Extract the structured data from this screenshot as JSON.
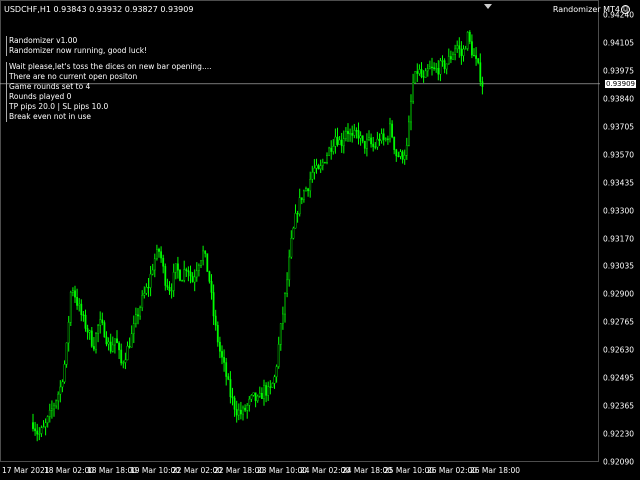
{
  "header": {
    "symbol_line": "USDCHF,H1  0.93843 0.93932 0.93827 0.93909",
    "ea_name": "Randomizer MT4",
    "ea_icon": "smiley-icon"
  },
  "log_lines": [
    "Randomizer v1.00",
    "Randomizer now running, good luck!",
    "",
    "Wait please,let's toss the dices on new bar opening....",
    "There are no current open positon",
    "Game rounds set to 4",
    "Rounds played 0",
    "TP pips 20.0 | SL pips 10.0",
    "Break even not in use"
  ],
  "price_scale": [
    "0.94240",
    "0.94105",
    "0.93975",
    "0.93840",
    "0.93705",
    "0.93570",
    "0.93435",
    "0.93300",
    "0.93170",
    "0.93035",
    "0.92900",
    "0.92765",
    "0.92630",
    "0.92495",
    "0.92365",
    "0.92230",
    "0.92090"
  ],
  "bid_price": "0.93909",
  "time_axis": [
    "17 Mar 2021",
    "18 Mar 02:00",
    "18 Mar 18:00",
    "19 Mar 10:00",
    "22 Mar 02:00",
    "22 Mar 18:00",
    "23 Mar 10:00",
    "24 Mar 02:00",
    "24 Mar 18:00",
    "25 Mar 10:00",
    "26 Mar 02:00",
    "26 Mar 18:00"
  ],
  "colors": {
    "candle": "#00ff00",
    "background": "#000000",
    "bid_line": "#c0c0c0",
    "text": "#ffffff"
  },
  "chart_data": {
    "type": "candlestick",
    "symbol": "USDCHF",
    "timeframe": "H1",
    "ylim": [
      0.9209,
      0.9424
    ],
    "close_path": [
      0.9228,
      0.9222,
      0.9225,
      0.9231,
      0.9238,
      0.9245,
      0.926,
      0.9295,
      0.9286,
      0.9278,
      0.9272,
      0.9265,
      0.9276,
      0.9272,
      0.9263,
      0.9269,
      0.9256,
      0.9262,
      0.927,
      0.928,
      0.9288,
      0.9294,
      0.9306,
      0.9311,
      0.9297,
      0.9292,
      0.9302,
      0.9298,
      0.9304,
      0.9296,
      0.9305,
      0.931,
      0.9298,
      0.9276,
      0.9262,
      0.9252,
      0.924,
      0.9234,
      0.9232,
      0.9236,
      0.924,
      0.9238,
      0.9244,
      0.9242,
      0.925,
      0.9272,
      0.9292,
      0.9315,
      0.933,
      0.9338,
      0.9342,
      0.935,
      0.9348,
      0.9355,
      0.936,
      0.9366,
      0.9362,
      0.937,
      0.9364,
      0.9368,
      0.9361,
      0.9363,
      0.936,
      0.9365,
      0.9363,
      0.937,
      0.9357,
      0.9356,
      0.936,
      0.939,
      0.9398,
      0.9392,
      0.9398,
      0.9397,
      0.9399,
      0.94,
      0.9404,
      0.941,
      0.9404,
      0.9414,
      0.9405,
      0.9398,
      0.9388
    ]
  }
}
